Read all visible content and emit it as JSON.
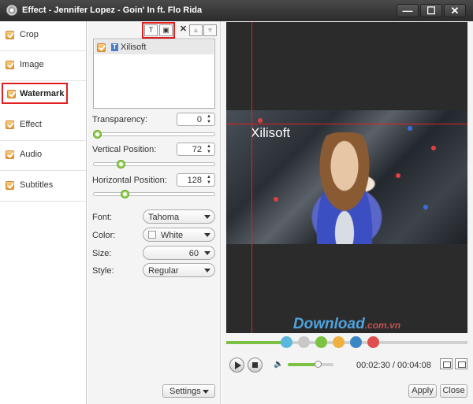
{
  "window": {
    "title": "Effect - Jennifer Lopez - Goin' In ft. Flo Rida",
    "minimize": "—",
    "maximize": "☐",
    "close": "✕"
  },
  "nav": {
    "items": [
      {
        "label": "Crop",
        "checked": true
      },
      {
        "label": "Image",
        "checked": true
      },
      {
        "label": "Watermark",
        "checked": true,
        "active": true
      },
      {
        "label": "Effect",
        "checked": true
      },
      {
        "label": "Audio",
        "checked": true
      },
      {
        "label": "Subtitles",
        "checked": true
      }
    ]
  },
  "toolbar": {
    "add_text_icon": "T",
    "add_image_icon": "▣",
    "delete_icon": "✕",
    "up_icon": "▲",
    "down_icon": "▼"
  },
  "watermarks": [
    {
      "label": "Xilisoft",
      "type_icon": "T",
      "checked": true
    }
  ],
  "controls": {
    "transparency": {
      "label": "Transparency:",
      "value": "0"
    },
    "vertical": {
      "label": "Vertical Position:",
      "value": "72"
    },
    "horizontal": {
      "label": "Horizontal Position:",
      "value": "128"
    },
    "font": {
      "label": "Font:",
      "value": "Tahoma"
    },
    "color": {
      "label": "Color:",
      "value": "White",
      "swatch": "#ffffff"
    },
    "size": {
      "label": "Size:",
      "value": "60"
    },
    "style": {
      "label": "Style:",
      "value": "Regular"
    },
    "settings_label": "Settings"
  },
  "preview": {
    "watermark_text": "Xilisoft",
    "site_brand": "Download",
    "site_domain": ".com.vn"
  },
  "player": {
    "time": "00:02:30 / 00:04:08",
    "timeline_colors": [
      "#5ab7de",
      "#c8c8c8",
      "#7cc242",
      "#f0b040",
      "#3b86c5",
      "#e05050"
    ],
    "accent": "#7cc242"
  },
  "footer": {
    "apply": "Apply",
    "close": "Close"
  }
}
